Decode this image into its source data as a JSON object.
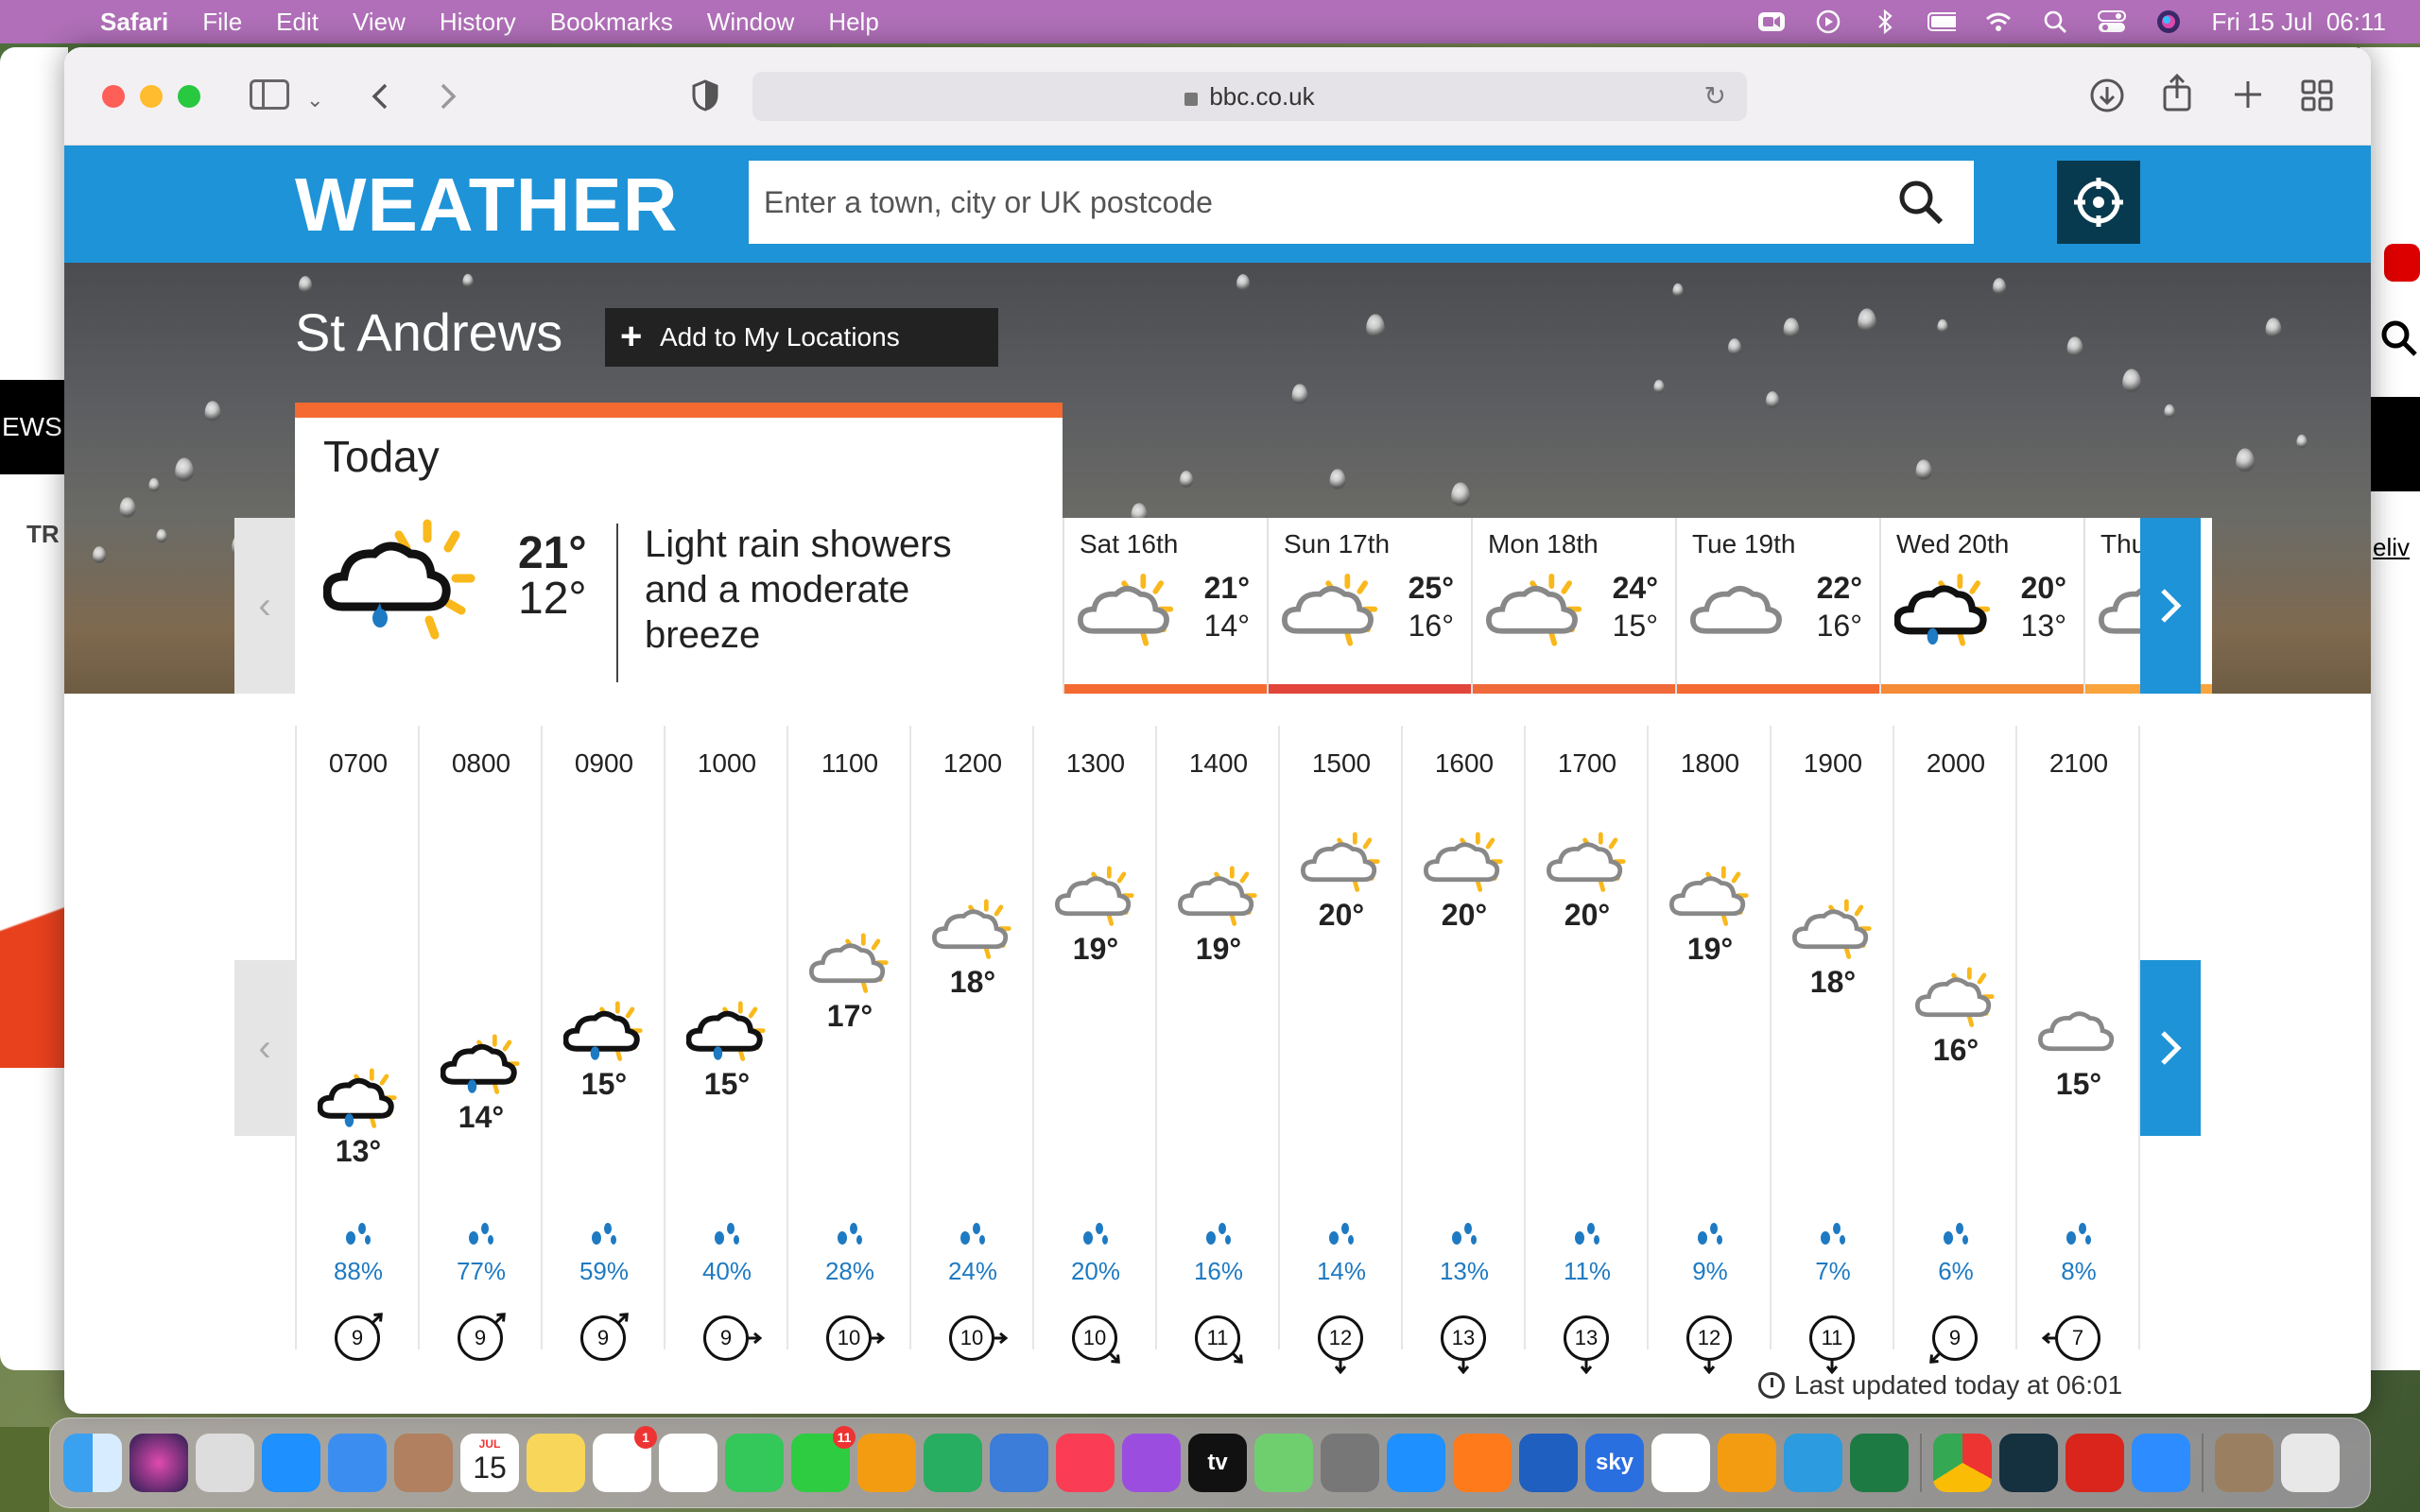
{
  "menubar": {
    "app": "Safari",
    "items": [
      "File",
      "Edit",
      "View",
      "History",
      "Bookmarks",
      "Window",
      "Help"
    ],
    "clock": "Fri 15 Jul  06:11"
  },
  "browser": {
    "url": "bbc.co.uk"
  },
  "background": {
    "left_text_1": "EWS",
    "left_text_2": "TR",
    "right_text": "eliv"
  },
  "weather": {
    "logo": "WEATHER",
    "search_placeholder": "Enter a town, city or UK postcode",
    "location": "St Andrews",
    "add_location": "Add to My Locations",
    "today": {
      "label": "Today",
      "high": "21°",
      "low": "12°",
      "description": "Light rain showers and a moderate breeze",
      "icon": "light-rain-sun-icon"
    },
    "days": [
      {
        "name": "Sat 16th",
        "high": "21°",
        "low": "14°",
        "icon": "sun-cloud-icon",
        "color": "#f46a31"
      },
      {
        "name": "Sun 17th",
        "high": "25°",
        "low": "16°",
        "icon": "sun-cloud-icon",
        "color": "#e2463b"
      },
      {
        "name": "Mon 18th",
        "high": "24°",
        "low": "15°",
        "icon": "sun-cloud-icon",
        "color": "#f0693a"
      },
      {
        "name": "Tue 19th",
        "high": "22°",
        "low": "16°",
        "icon": "cloud-icon",
        "color": "#f46a31"
      },
      {
        "name": "Wed 20th",
        "high": "20°",
        "low": "13°",
        "icon": "light-rain-sun-icon",
        "color": "#f58b36"
      },
      {
        "name": "Thu",
        "high": "",
        "low": "",
        "icon": "sun-cloud-icon",
        "color": "#f9a43c"
      }
    ],
    "hours": [
      {
        "time": "0700",
        "temp": "13°",
        "icon": "light-rain-sun-icon",
        "rain": "88%",
        "wind": "9",
        "dir": "ne"
      },
      {
        "time": "0800",
        "temp": "14°",
        "icon": "light-rain-sun-icon",
        "rain": "77%",
        "wind": "9",
        "dir": "ne"
      },
      {
        "time": "0900",
        "temp": "15°",
        "icon": "light-rain-sun-icon",
        "rain": "59%",
        "wind": "9",
        "dir": "ne"
      },
      {
        "time": "1000",
        "temp": "15°",
        "icon": "light-rain-sun-icon",
        "rain": "40%",
        "wind": "9",
        "dir": "e"
      },
      {
        "time": "1100",
        "temp": "17°",
        "icon": "sun-cloud-icon",
        "rain": "28%",
        "wind": "10",
        "dir": "e"
      },
      {
        "time": "1200",
        "temp": "18°",
        "icon": "sun-cloud-icon",
        "rain": "24%",
        "wind": "10",
        "dir": "e"
      },
      {
        "time": "1300",
        "temp": "19°",
        "icon": "sun-cloud-icon",
        "rain": "20%",
        "wind": "10",
        "dir": "se"
      },
      {
        "time": "1400",
        "temp": "19°",
        "icon": "sun-cloud-icon",
        "rain": "16%",
        "wind": "11",
        "dir": "se"
      },
      {
        "time": "1500",
        "temp": "20°",
        "icon": "sun-cloud-icon",
        "rain": "14%",
        "wind": "12",
        "dir": "s"
      },
      {
        "time": "1600",
        "temp": "20°",
        "icon": "sun-cloud-icon",
        "rain": "13%",
        "wind": "13",
        "dir": "s"
      },
      {
        "time": "1700",
        "temp": "20°",
        "icon": "sun-cloud-icon",
        "rain": "11%",
        "wind": "13",
        "dir": "s"
      },
      {
        "time": "1800",
        "temp": "19°",
        "icon": "sun-cloud-icon",
        "rain": "9%",
        "wind": "12",
        "dir": "s"
      },
      {
        "time": "1900",
        "temp": "18°",
        "icon": "sun-cloud-icon",
        "rain": "7%",
        "wind": "11",
        "dir": "s"
      },
      {
        "time": "2000",
        "temp": "16°",
        "icon": "sun-cloud-icon",
        "rain": "6%",
        "wind": "9",
        "dir": "sw"
      },
      {
        "time": "2100",
        "temp": "15°",
        "icon": "cloud-icon",
        "rain": "8%",
        "wind": "7",
        "dir": "w"
      }
    ],
    "last_updated": "Last updated today at 06:01"
  },
  "dock": {
    "calendar_month": "JUL",
    "calendar_day": "15",
    "badges": {
      "reminders": "1",
      "facetime": "11"
    },
    "apps": [
      "finder-icon",
      "siri-icon",
      "launchpad-icon",
      "safari-icon",
      "mail-icon",
      "contacts-icon",
      "calendar-icon",
      "notes-icon",
      "reminders-icon",
      "photos-icon",
      "messages-icon",
      "facetime-icon",
      "pages-icon",
      "numbers-icon",
      "keynote-icon",
      "music-icon",
      "podcasts-icon",
      "tv-icon",
      "maps-icon",
      "system-preferences-icon",
      "app-store-icon",
      "firefox-icon",
      "word-icon",
      "sky-go-icon",
      "news-icon",
      "books-icon",
      "xcode-icon",
      "excel-icon",
      "chrome-icon",
      "sketch-icon",
      "acrobat-icon",
      "zoom-icon",
      "preview-icon",
      "trash-icon"
    ],
    "tv_label": "tv",
    "sky_label": "sky"
  }
}
